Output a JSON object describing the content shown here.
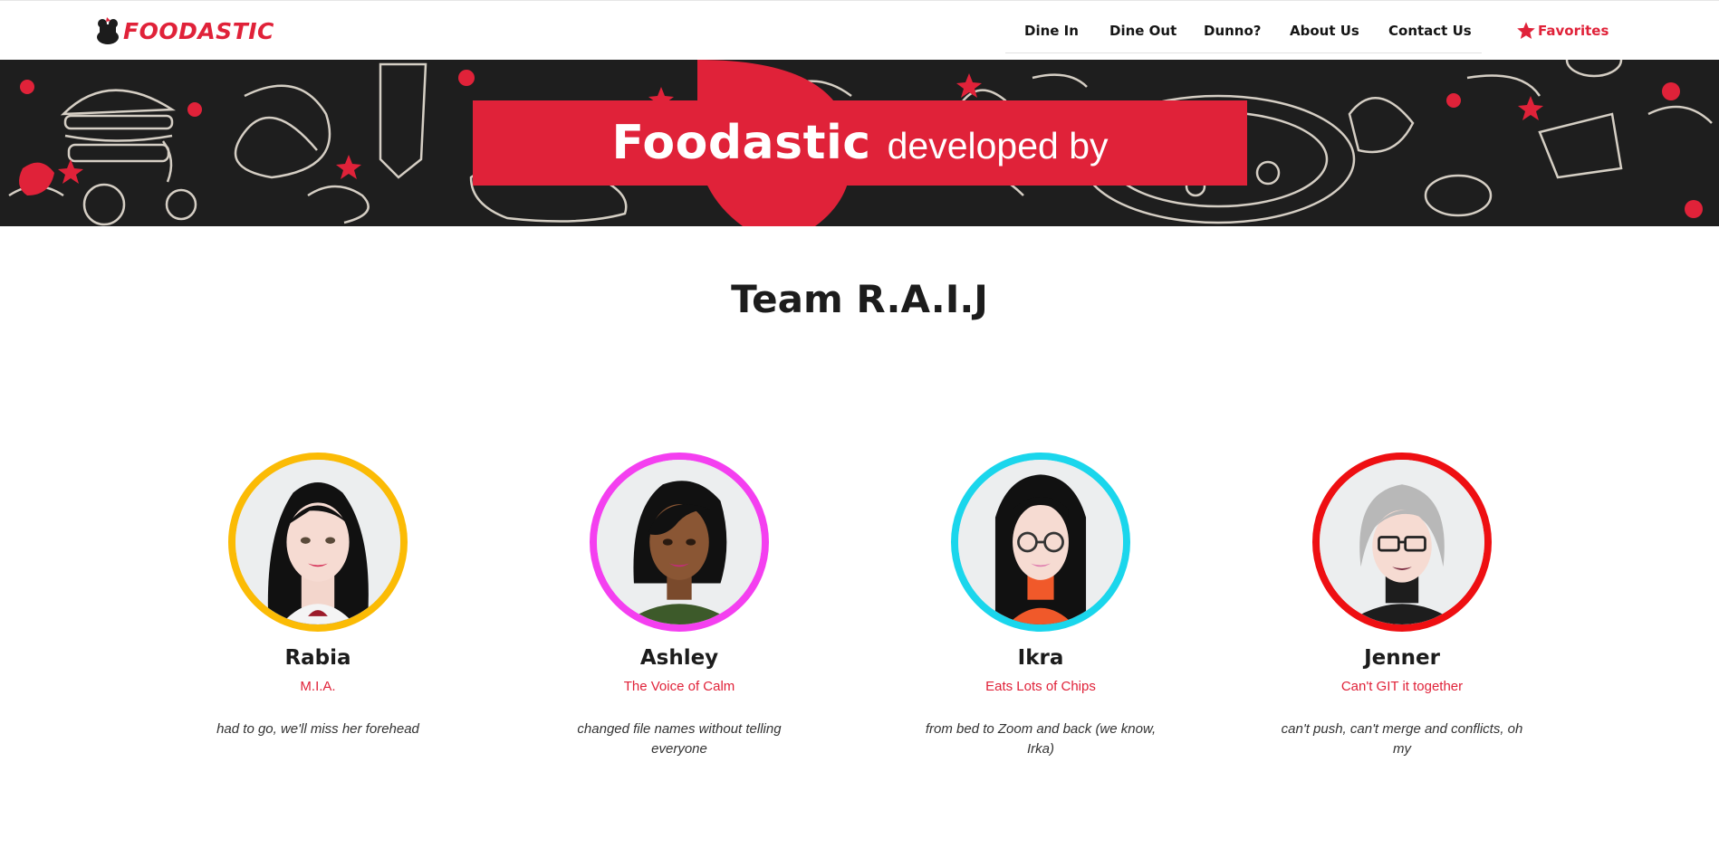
{
  "brand": {
    "logo_text": "FOODASTIC",
    "accent_color": "#e02239"
  },
  "nav": {
    "items": [
      {
        "label": "Dine In"
      },
      {
        "label": "Dine Out"
      },
      {
        "label": "Dunno?"
      },
      {
        "label": "About Us"
      },
      {
        "label": "Contact Us"
      }
    ],
    "favorites": {
      "label": "Favorites",
      "icon": "star-icon"
    }
  },
  "banner": {
    "brand": "Foodastic",
    "subtitle": "developed by"
  },
  "team": {
    "title": "Team R.A.I.J",
    "members": [
      {
        "name": "Rabia",
        "role": "M.I.A.",
        "description": "had to go, we'll miss her forehead",
        "ring_color": "#fbbb05"
      },
      {
        "name": "Ashley",
        "role": "The Voice of Calm",
        "description": "changed file names without telling everyone",
        "ring_color": "#f43ff0"
      },
      {
        "name": "Ikra",
        "role": "Eats Lots of Chips",
        "description": "from bed to Zoom and back (we know, Irka)",
        "ring_color": "#1ad6ec"
      },
      {
        "name": "Jenner",
        "role": "Can't GIT it together",
        "description": "can't push, can't merge and conflicts, oh my",
        "ring_color": "#ee0f12"
      }
    ]
  }
}
